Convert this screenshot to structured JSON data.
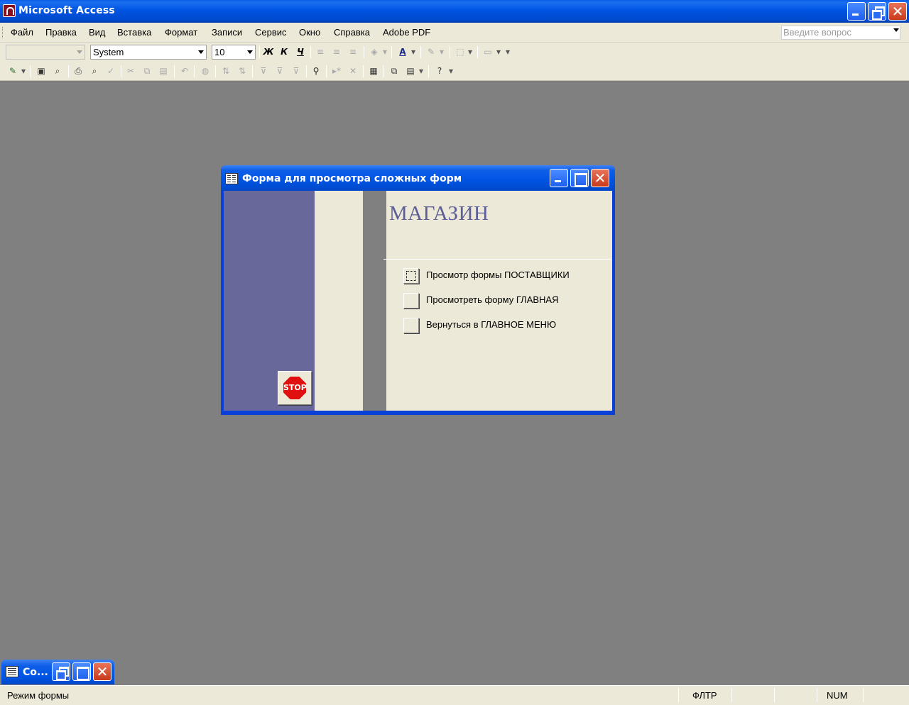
{
  "app": {
    "title": "Microsoft Access"
  },
  "menu": {
    "items": [
      "Файл",
      "Правка",
      "Вид",
      "Вставка",
      "Формат",
      "Записи",
      "Сервис",
      "Окно",
      "Справка",
      "Adobe PDF"
    ],
    "ask_placeholder": "Введите вопрос"
  },
  "toolbar": {
    "object_combo": "",
    "font_name": "System",
    "font_size": "10",
    "bold_label": "Ж",
    "italic_label": "К",
    "underline_label": "Ч"
  },
  "form": {
    "window_title": "Форма для просмотра сложных форм",
    "heading": "МАГАЗИН",
    "options": [
      {
        "label": "Просмотр формы ПОСТАВЩИКИ"
      },
      {
        "label": "Просмотреть форму ГЛАВНАЯ"
      },
      {
        "label": "Вернуться в ГЛАВНОЕ МЕНЮ"
      }
    ],
    "stop_label": "STOP"
  },
  "minimized": {
    "title": "Со..."
  },
  "status": {
    "mode": "Режим формы",
    "filter": "ФЛТР",
    "num": "NUM"
  },
  "colors": {
    "title_blue": "#0054e3",
    "panel_bg": "#ece9d8",
    "workspace": "#808080",
    "form_purple": "#68689a",
    "heading_color": "#5e5e96",
    "stop_red": "#e01010"
  }
}
